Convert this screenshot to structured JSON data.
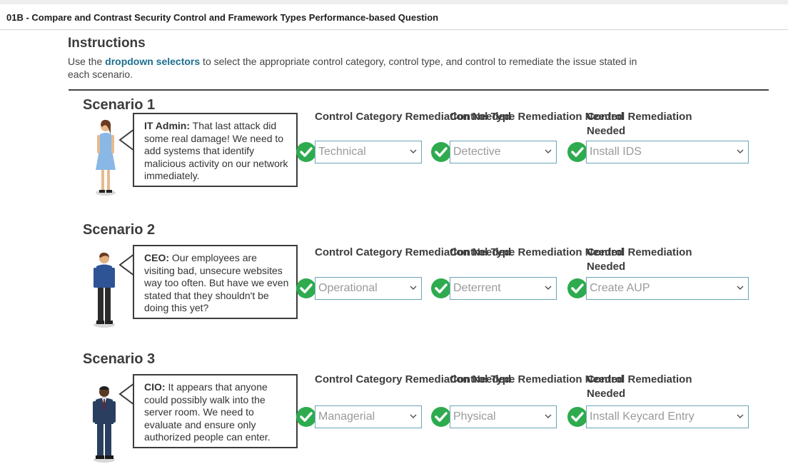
{
  "header": {
    "title": "01B - Compare and Contrast Security Control and Framework Types Performance-based Question"
  },
  "instructions": {
    "title": "Instructions",
    "text_before": "Use the ",
    "highlight": "dropdown selectors",
    "text_after": " to select the appropriate control category, control type, and control to remediate the issue stated in each scenario."
  },
  "columns": {
    "category": "Control Category Remediation Needed",
    "type": "Control Type Remediation Needed",
    "remediation": "Control Remediation Needed"
  },
  "scenarios": [
    {
      "title": "Scenario 1",
      "speaker": "IT Admin:",
      "message": " That last attack did some real damage! We need to add systems that identify malicious activity on our network immediately.",
      "category": "Technical",
      "type": "Detective",
      "remediation": "Install IDS"
    },
    {
      "title": "Scenario 2",
      "speaker": "CEO:",
      "message": " Our employees are visiting bad, unsecure websites way too often.  But have we even stated that they shouldn't be doing this yet?",
      "category": "Operational",
      "type": "Deterrent",
      "remediation": "Create AUP"
    },
    {
      "title": "Scenario 3",
      "speaker": "CIO:",
      "message": " It appears that anyone could possibly walk into the server room. We need to evaluate and ensure only authorized people can enter.",
      "category": "Managerial",
      "type": "Physical",
      "remediation": "Install Keycard Entry"
    }
  ],
  "icons": {
    "check": "check-circle-icon",
    "caret": "chevron-down-icon",
    "person1": "woman-avatar",
    "person2": "man-avatar",
    "person3": "businessman-avatar"
  },
  "colors": {
    "check_green": "#2eab4f",
    "select_border": "#6aa5b5",
    "highlight": "#1b6e8e"
  }
}
